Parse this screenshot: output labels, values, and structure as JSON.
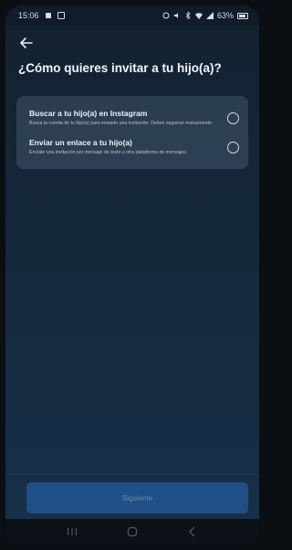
{
  "status_bar": {
    "time": "15:06",
    "battery": "63%"
  },
  "page": {
    "title": "¿Cómo quieres invitar a tu hijo(a)?"
  },
  "options": [
    {
      "title": "Buscar a tu hijo(a) en Instagram",
      "description": "Busca la cuenta de tu hijo(a) para enviarle una invitación. Deben seguirse mutuamente."
    },
    {
      "title": "Enviar un enlace a tu hijo(a)",
      "description": "Envíale una invitación por mensaje de texto u otra plataforma de mensajes."
    }
  ],
  "footer": {
    "next_label": "Siguiente"
  },
  "colors": {
    "background_top": "#14212f",
    "background_bottom": "#16314a",
    "card": "#3a4f66",
    "button": "#1f4f85",
    "button_text": "#6f8cae"
  },
  "icons": {
    "back": "back-arrow-icon",
    "radio": "radio-unselected-icon",
    "nav": [
      "recent-apps-icon",
      "home-icon",
      "back-nav-icon"
    ]
  }
}
